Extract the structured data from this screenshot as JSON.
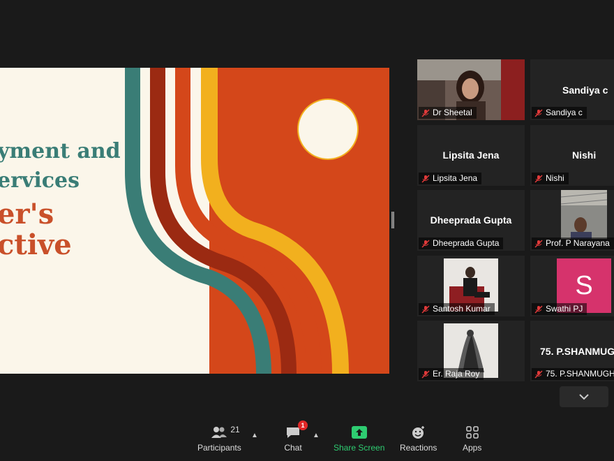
{
  "slide": {
    "lines": [
      "yment and",
      "ervices",
      "er's",
      "ctive"
    ]
  },
  "gallery": {
    "tiles": [
      {
        "nameplate": "Dr Sheetal",
        "big_name": ""
      },
      {
        "nameplate": "Sandiya c",
        "big_name": "Sandiya c"
      },
      {
        "nameplate": "Lipsita Jena",
        "big_name": "Lipsita Jena"
      },
      {
        "nameplate": "Nishi",
        "big_name": "Nishi"
      },
      {
        "nameplate": "Dheeprada Gupta",
        "big_name": "Dheeprada Gupta"
      },
      {
        "nameplate": "Prof. P Narayana",
        "big_name": ""
      },
      {
        "nameplate": "Santosh Kumar",
        "big_name": ""
      },
      {
        "nameplate": "Swathi PJ",
        "big_name": "",
        "avatar_letter": "S",
        "avatar_color": "#d6336c"
      },
      {
        "nameplate": "Er. Raja Roy",
        "big_name": ""
      },
      {
        "nameplate": "75. P.SHANMUGH",
        "big_name": "75. P.SHANMUG"
      }
    ]
  },
  "toolbar": {
    "participants_label": "Participants",
    "participants_count": "21",
    "chat_label": "Chat",
    "chat_badge": "1",
    "share_label": "Share Screen",
    "reactions_label": "Reactions",
    "apps_label": "Apps"
  },
  "colors": {
    "teal": "#3a7d76",
    "maroon": "#9b2a12",
    "orange": "#d4471a",
    "gold": "#f2b01e",
    "share_green": "#2ecc71",
    "badge_red": "#e02828"
  }
}
